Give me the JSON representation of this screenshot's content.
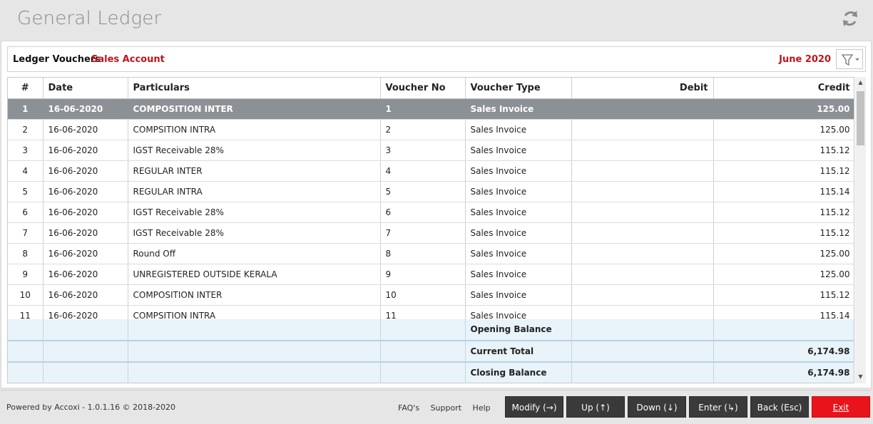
{
  "app": {
    "title": "General Ledger"
  },
  "subheader": {
    "label": "Ledger Vouchers",
    "account": "Sales Account",
    "period": "June 2020"
  },
  "table": {
    "columns": [
      "#",
      "Date",
      "Particulars",
      "Voucher No",
      "Voucher Type",
      "Debit",
      "Credit"
    ],
    "rows": [
      {
        "n": "1",
        "date": "16-06-2020",
        "particulars": "COMPOSITION INTER",
        "vno": "1",
        "vtype": "Sales Invoice",
        "debit": "",
        "credit": "125.00"
      },
      {
        "n": "2",
        "date": "16-06-2020",
        "particulars": "COMPSITION INTRA",
        "vno": "2",
        "vtype": "Sales Invoice",
        "debit": "",
        "credit": "125.00"
      },
      {
        "n": "3",
        "date": "16-06-2020",
        "particulars": "IGST Receivable 28%",
        "vno": "3",
        "vtype": "Sales Invoice",
        "debit": "",
        "credit": "115.12"
      },
      {
        "n": "4",
        "date": "16-06-2020",
        "particulars": "REGULAR INTER",
        "vno": "4",
        "vtype": "Sales Invoice",
        "debit": "",
        "credit": "115.12"
      },
      {
        "n": "5",
        "date": "16-06-2020",
        "particulars": "REGULAR INTRA",
        "vno": "5",
        "vtype": "Sales Invoice",
        "debit": "",
        "credit": "115.14"
      },
      {
        "n": "6",
        "date": "16-06-2020",
        "particulars": "IGST Receivable 28%",
        "vno": "6",
        "vtype": "Sales Invoice",
        "debit": "",
        "credit": "115.12"
      },
      {
        "n": "7",
        "date": "16-06-2020",
        "particulars": "IGST Receivable 28%",
        "vno": "7",
        "vtype": "Sales Invoice",
        "debit": "",
        "credit": "115.12"
      },
      {
        "n": "8",
        "date": "16-06-2020",
        "particulars": "Round Off",
        "vno": "8",
        "vtype": "Sales Invoice",
        "debit": "",
        "credit": "125.00"
      },
      {
        "n": "9",
        "date": "16-06-2020",
        "particulars": "UNREGISTERED OUTSIDE KERALA",
        "vno": "9",
        "vtype": "Sales Invoice",
        "debit": "",
        "credit": "125.00"
      },
      {
        "n": "10",
        "date": "16-06-2020",
        "particulars": "COMPOSITION INTER",
        "vno": "10",
        "vtype": "Sales Invoice",
        "debit": "",
        "credit": "115.12"
      },
      {
        "n": "11",
        "date": "16-06-2020",
        "particulars": "COMPSITION INTRA",
        "vno": "11",
        "vtype": "Sales Invoice",
        "debit": "",
        "credit": "115.14"
      }
    ],
    "summary": [
      {
        "label": "Opening Balance",
        "debit": "",
        "credit": ""
      },
      {
        "label": "Current Total",
        "debit": "",
        "credit": "6,174.98"
      },
      {
        "label": "Closing Balance",
        "debit": "",
        "credit": "6,174.98"
      }
    ]
  },
  "footer": {
    "powered": "Powered by Accoxi - 1.0.1.16 © 2018-2020",
    "links": [
      "FAQ's",
      "Support",
      "Help"
    ],
    "buttons": {
      "modify": "Modify (→)",
      "up": "Up (↑)",
      "down": "Down (↓)",
      "enter": "Enter (↳)",
      "back": "Back (Esc)",
      "exit": "Exit"
    }
  },
  "colors": {
    "accent_red": "#c0141c",
    "exit_red": "#e8131b",
    "selected_row": "#8c9196",
    "summary_bg": "#e9f3fa"
  },
  "icons": {
    "refresh": "refresh-icon",
    "filter": "filter-icon"
  }
}
